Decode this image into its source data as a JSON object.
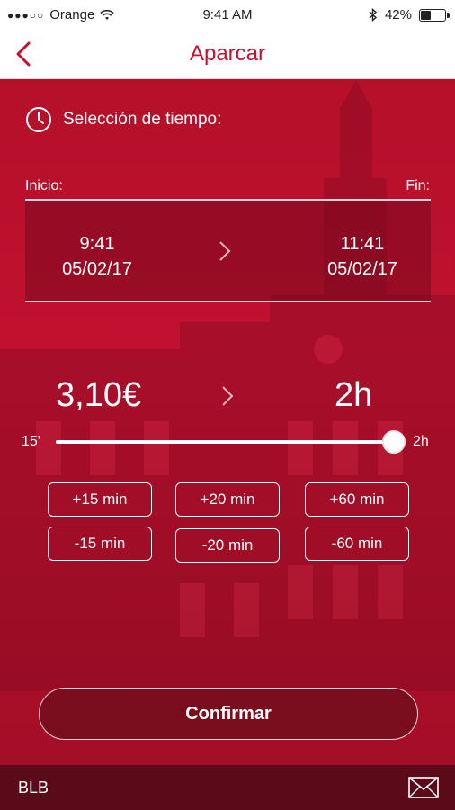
{
  "status_bar": {
    "carrier": "Orange",
    "signal_dots": "●●●○○",
    "time": "9:41 AM",
    "battery_percent": "42%",
    "battery_level": 0.42
  },
  "nav": {
    "title": "Aparcar"
  },
  "time_selection": {
    "heading": "Selección de tiempo:",
    "start_label": "Inicio:",
    "end_label": "Fin:",
    "start_time": "9:41",
    "start_date": "05/02/17",
    "end_time": "11:41",
    "end_date": "05/02/17"
  },
  "summary": {
    "price": "3,10€",
    "duration": "2h"
  },
  "slider": {
    "min_label": "15'",
    "max_label": "2h",
    "level": 1.0
  },
  "adjust_buttons": {
    "plus_15": "+15 min",
    "plus_20": "+20 min",
    "plus_60": "+60 min",
    "minus_15": "-15 min",
    "minus_20": "-20 min",
    "minus_60": "-60 min"
  },
  "confirm_label": "Confirmar",
  "footer": {
    "label": "BLB"
  },
  "colors": {
    "accent": "#c8102e",
    "footer": "#5a0a18"
  },
  "icons": {
    "back": "chevron-left-icon",
    "clock": "clock-icon",
    "arrow": "chevron-right-icon",
    "mail": "mail-icon",
    "wifi": "wifi-icon",
    "bluetooth": "bluetooth-icon",
    "battery": "battery-icon"
  }
}
